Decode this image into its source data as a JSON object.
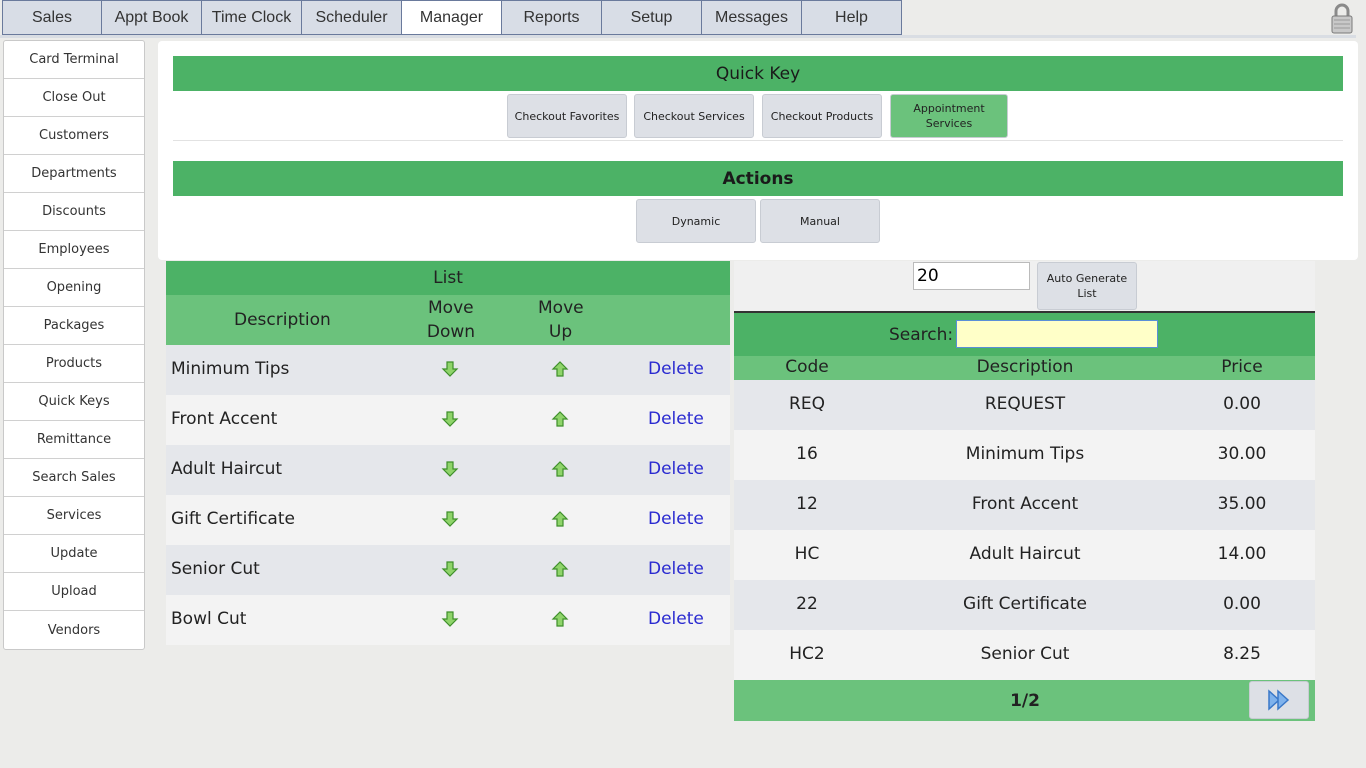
{
  "top_tabs": [
    "Sales",
    "Appt Book",
    "Time Clock",
    "Scheduler",
    "Manager",
    "Reports",
    "Setup",
    "Messages",
    "Help"
  ],
  "active_tab": "Manager",
  "sidebar": {
    "items": [
      "Card Terminal",
      "Close Out",
      "Customers",
      "Departments",
      "Discounts",
      "Employees",
      "Opening",
      "Packages",
      "Products",
      "Quick Keys",
      "Remittance",
      "Search Sales",
      "Services",
      "Update",
      "Upload",
      "Vendors"
    ]
  },
  "quick_key": {
    "title": "Quick Key",
    "buttons": [
      "Checkout Favorites",
      "Checkout Services",
      "Checkout Products",
      "Appointment Services"
    ],
    "selected": "Appointment Services"
  },
  "actions": {
    "title": "Actions",
    "buttons": [
      "Dynamic",
      "Manual"
    ]
  },
  "list": {
    "title": "List",
    "headers": {
      "description": "Description",
      "move_down_1": "Move",
      "move_down_2": "Down",
      "move_up_1": "Move",
      "move_up_2": "Up"
    },
    "delete_label": "Delete",
    "rows": [
      "Minimum Tips",
      "Front Accent",
      "Adult Haircut",
      "Gift Certificate",
      "Senior Cut",
      "Bowl Cut"
    ]
  },
  "generator": {
    "count_value": "20",
    "auto_button_label": "Auto Generate List"
  },
  "search": {
    "label": "Search:",
    "value": "",
    "headers": {
      "code": "Code",
      "description": "Description",
      "price": "Price"
    },
    "rows": [
      {
        "code": "REQ",
        "description": "REQUEST",
        "price": "0.00"
      },
      {
        "code": "16",
        "description": "Minimum Tips",
        "price": "30.00"
      },
      {
        "code": "12",
        "description": "Front Accent",
        "price": "35.00"
      },
      {
        "code": "HC",
        "description": "Adult Haircut",
        "price": "14.00"
      },
      {
        "code": "22",
        "description": "Gift Certificate",
        "price": "0.00"
      },
      {
        "code": "HC2",
        "description": "Senior Cut",
        "price": "8.25"
      }
    ],
    "page": "1/2"
  },
  "icons": {
    "lock": "lock-icon",
    "down": "arrow-down-icon",
    "up": "arrow-up-icon",
    "next": "double-chevron-right-icon"
  },
  "colors": {
    "green_header": "#4cb266",
    "green_light": "#6bc27c",
    "link": "#2a2ad0"
  }
}
